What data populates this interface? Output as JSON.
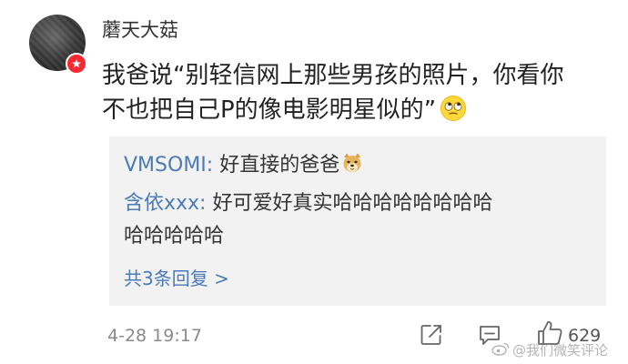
{
  "post": {
    "username": "蘑天大菇",
    "comment_lines": [
      "我爸说“别轻信网上那些男孩的照片，你看你",
      "不也把自己P的像电影明星似的”"
    ],
    "comment_emoji": "eye-roll-emoji",
    "time": "4-28 19:17",
    "like_count": "629"
  },
  "replies": [
    {
      "name": "VMSOMI:",
      "text": " 好直接的爸爸",
      "emoji": "doge-emoji"
    },
    {
      "name": "含依xxx:",
      "text_lines": [
        " 好可爱好真实哈哈哈哈哈哈哈哈",
        "哈哈哈哈哈"
      ]
    }
  ],
  "more_replies_label": "共3条回复 >",
  "watermark": "@我们微笑评论",
  "colors": {
    "link_blue": "#4a7ab8",
    "reply_bg": "#f2f2f2",
    "badge_red": "#f5292f",
    "meta_gray": "#8a8a8a"
  },
  "icons": {
    "share": "share-icon",
    "comment": "comment-icon",
    "like": "like-icon",
    "vip": "vip-badge-icon",
    "weibo": "weibo-logo-icon"
  }
}
